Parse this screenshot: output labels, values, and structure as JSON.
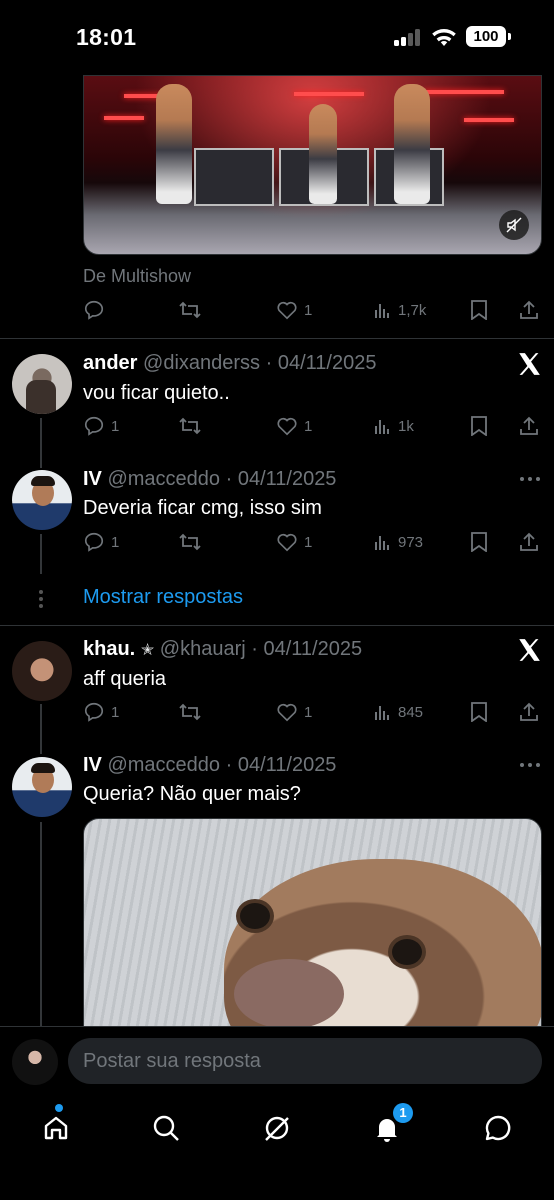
{
  "status_bar": {
    "time": "18:01",
    "battery": "100"
  },
  "top_post": {
    "source": "De Multishow",
    "actions": {
      "replies": "",
      "reposts": "",
      "likes": "1",
      "views": "1,7k"
    }
  },
  "replies": [
    {
      "name": "ander",
      "handle": "@dixanderss · 04/11/2025",
      "text": "vou ficar quieto..",
      "actions": {
        "replies": "1",
        "reposts": "",
        "likes": "1",
        "views": "1k"
      }
    },
    {
      "name": "IV",
      "handle": "@macceddo · 04/11/2025",
      "text": "Deveria ficar cmg, isso sim",
      "actions": {
        "replies": "1",
        "reposts": "",
        "likes": "1",
        "views": "973"
      }
    },
    {
      "name": "khau.",
      "badge": "✭",
      "handle": "@khauarj · 04/11/2025",
      "text": "aff queria",
      "actions": {
        "replies": "1",
        "reposts": "",
        "likes": "1",
        "views": "845"
      }
    },
    {
      "name": "IV",
      "handle": "@macceddo · 04/11/2025",
      "text": "Queria? Não quer mais?"
    }
  ],
  "show_replies_label": "Mostrar respostas",
  "composer": {
    "placeholder": "Postar sua resposta"
  },
  "tab_bar": {
    "notifications_badge": "1"
  },
  "colors": {
    "background": "#000000",
    "accent": "#1d9bf0",
    "muted": "#71767b",
    "divider": "#2f3336"
  }
}
